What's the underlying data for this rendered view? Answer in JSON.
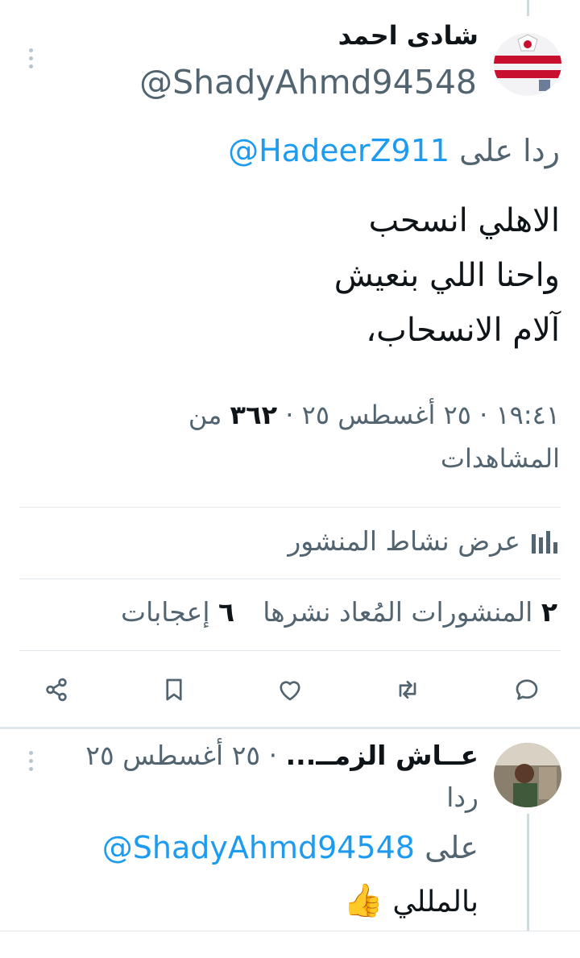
{
  "tweet": {
    "display_name": "شادى احمد",
    "handle": "@ShadyAhmd94548",
    "reply_prefix": "ردا على",
    "reply_to": "@HadeerZ911",
    "text_lines": [
      "الاهلي انسحب",
      "واحنا اللي بنعيش",
      "آلام الانسحاب،"
    ],
    "time": "١٩:٤١",
    "date": "٢٥ أغسطس ٢٥",
    "separator": "·",
    "views_count": "٣٦٢",
    "views_label_1": "من",
    "views_label_2": "المشاهدات",
    "activity_label": "عرض نشاط المنشور",
    "reposts_count": "٢",
    "reposts_label": "المنشورات المُعاد نشرها",
    "likes_count": "٦",
    "likes_label": "إعجابات"
  },
  "actions": [
    {
      "name": "reply",
      "icon": "reply-icon"
    },
    {
      "name": "repost",
      "icon": "repost-icon"
    },
    {
      "name": "like",
      "icon": "heart-icon"
    },
    {
      "name": "bookmark",
      "icon": "bookmark-icon"
    },
    {
      "name": "share",
      "icon": "share-icon"
    }
  ],
  "reply": {
    "display_name": "عــاش الزمــ...",
    "dot": "·",
    "date": "٢٥ أغسطس ٢٥",
    "reply_prefix_1": "ردا",
    "reply_prefix_2": "على",
    "reply_to": "@ShadyAhmd94548",
    "text": "بالمللي",
    "emoji": "👍"
  },
  "colors": {
    "link": "#1d9bf0",
    "muted": "#536471",
    "divider": "#e1e8ed",
    "thread_line": "#cfd9de"
  }
}
